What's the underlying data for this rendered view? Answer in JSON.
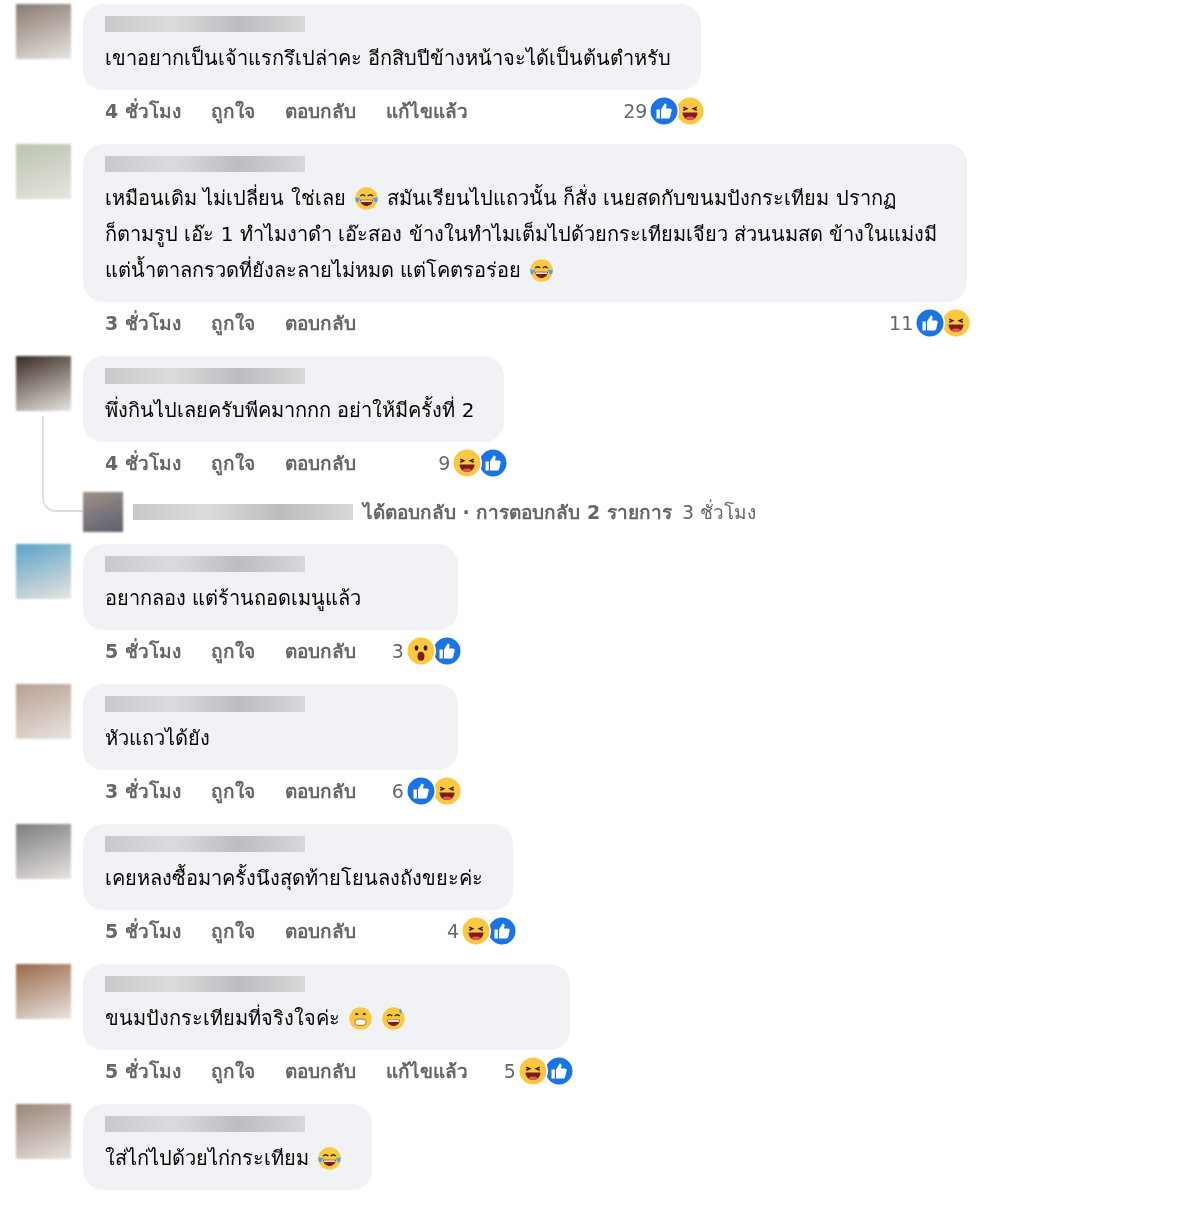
{
  "comments": [
    {
      "lines": [
        [
          {
            "kind": "text",
            "text": "เขาอยากเป็นเจ้าแรกรึเปล่าคะ อีกสิบปีข้างหน้าจะได้เป็นต้นตำหรับ"
          }
        ]
      ],
      "time": "4 ชั่วโมง",
      "like": "ถูกใจ",
      "reply": "ตอบกลับ",
      "edited": "แก้ไขแล้ว",
      "reaction_count": "29",
      "reactions": [
        {
          "kind": "like"
        },
        {
          "kind": "haha"
        }
      ]
    },
    {
      "lines": [
        [
          {
            "kind": "text",
            "text": "เหมือนเดิม ไม่เปลี่ยน ใช่เลย"
          },
          {
            "kind": "tears-of-joy"
          },
          {
            "kind": "text",
            "text": "สมันเรียนไปแถวนั้น ก็สั่ง เนยสดกับขนมปังกระเทียม ปรากฏ"
          }
        ],
        [
          {
            "kind": "text",
            "text": "ก็ตามรูป เอ๊ะ 1 ทำไมงาดำ เอ๊ะสอง ข้างในทำไมเต็มไปด้วยกระเทียมเจียว ส่วนนมสด ข้างในแม่งมี"
          }
        ],
        [
          {
            "kind": "text",
            "text": "แต่น้ำตาลกรวดที่ยังละลายไม่หมด แต่โคตรอร่อย"
          },
          {
            "kind": "tears-of-joy"
          }
        ]
      ],
      "time": "3 ชั่วโมง",
      "like": "ถูกใจ",
      "reply": "ตอบกลับ",
      "reaction_count": "11",
      "reactions": [
        {
          "kind": "like"
        },
        {
          "kind": "haha"
        }
      ]
    },
    {
      "lines": [
        [
          {
            "kind": "text",
            "text": "พึ่งกินไปเลยครับพีคมากกก อย่าให้มีครั้งที่ 2"
          }
        ]
      ],
      "time": "4 ชั่วโมง",
      "like": "ถูกใจ",
      "reply": "ตอบกลับ",
      "reaction_count": "9",
      "reactions": [
        {
          "kind": "haha"
        },
        {
          "kind": "like"
        }
      ],
      "replies": {
        "label": "ได้ตอบกลับ · การตอบกลับ 2 รายการ",
        "time": "3 ชั่วโมง"
      }
    },
    {
      "lines": [
        [
          {
            "kind": "text",
            "text": "อยากลอง แต่ร้านถอดเมนูแล้ว"
          }
        ]
      ],
      "time": "5 ชั่วโมง",
      "like": "ถูกใจ",
      "reply": "ตอบกลับ",
      "reaction_count": "3",
      "reactions": [
        {
          "kind": "wow"
        },
        {
          "kind": "like"
        }
      ]
    },
    {
      "lines": [
        [
          {
            "kind": "text",
            "text": "หัวแถวได้ยัง"
          }
        ]
      ],
      "time": "3 ชั่วโมง",
      "like": "ถูกใจ",
      "reply": "ตอบกลับ",
      "reaction_count": "6",
      "reactions": [
        {
          "kind": "like"
        },
        {
          "kind": "haha"
        }
      ]
    },
    {
      "lines": [
        [
          {
            "kind": "text",
            "text": "เคยหลงซื้อมาครั้งนึงสุดท้ายโยนลงถังขยะค่ะ"
          }
        ]
      ],
      "time": "5 ชั่วโมง",
      "like": "ถูกใจ",
      "reply": "ตอบกลับ",
      "reaction_count": "4",
      "reactions": [
        {
          "kind": "haha"
        },
        {
          "kind": "like"
        }
      ]
    },
    {
      "lines": [
        [
          {
            "kind": "text",
            "text": "ขนมปังกระเทียมที่จริงใจค่ะ"
          },
          {
            "kind": "grimace"
          },
          {
            "kind": "sweat-smile"
          }
        ]
      ],
      "time": "5 ชั่วโมง",
      "like": "ถูกใจ",
      "reply": "ตอบกลับ",
      "edited": "แก้ไขแล้ว",
      "reaction_count": "5",
      "reactions": [
        {
          "kind": "haha"
        },
        {
          "kind": "like"
        }
      ]
    },
    {
      "lines": [
        [
          {
            "kind": "text",
            "text": "ใส่ไก่ไปด้วยไก่กระเทียม"
          },
          {
            "kind": "tears-of-joy"
          }
        ]
      ]
    }
  ]
}
